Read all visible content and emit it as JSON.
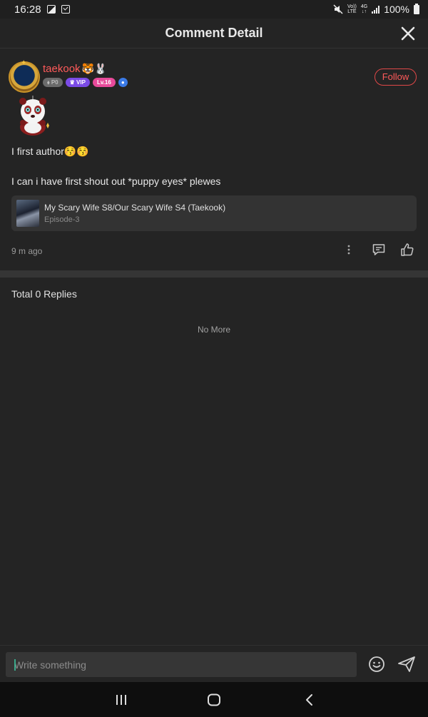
{
  "status_bar": {
    "time": "16:28",
    "battery": "100%",
    "network_top": "Vo))",
    "network_bottom": "LTE",
    "net_type_top": "4G",
    "net_type_bottom": "↓↑",
    "icons": [
      "gallery-icon",
      "check-icon",
      "mute-icon",
      "signal-icon",
      "battery-icon"
    ]
  },
  "header": {
    "title": "Comment Detail",
    "close_icon": "close-icon"
  },
  "comment": {
    "username": "taekook",
    "username_emojis": "🐯🐰",
    "badges": {
      "points": "P0",
      "vip": "VIP",
      "level": "Lv.16"
    },
    "follow_label": "Follow",
    "line1": "I first author😚😚",
    "line2": "I can i have first shout out *puppy eyes* plewes",
    "time_ago": "9 m ago"
  },
  "work_card": {
    "title": "My Scary Wife S8/Our Scary Wife S4 (Taekook)",
    "episode": "Episode-3"
  },
  "replies": {
    "total_label": "Total 0 Replies",
    "end_label": "No More"
  },
  "input": {
    "placeholder": "Write something"
  },
  "colors": {
    "accent": "#ff5a5a",
    "background": "#242424",
    "card": "#333333"
  }
}
